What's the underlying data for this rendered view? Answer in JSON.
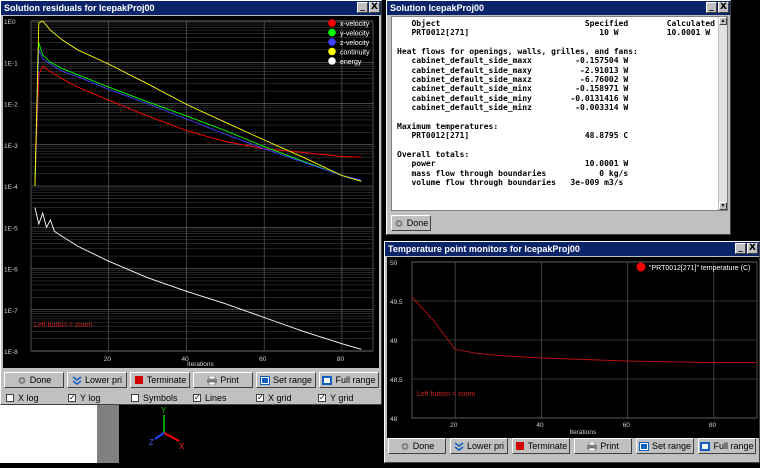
{
  "residuals_window": {
    "title": "Solution residuals for IcepakProj00",
    "title_buttons": [
      "_",
      "X"
    ],
    "legend": [
      {
        "label": "x-velocity",
        "color": "#ff0000"
      },
      {
        "label": "y-velocity",
        "color": "#00ff00"
      },
      {
        "label": "z-velocity",
        "color": "#4040ff"
      },
      {
        "label": "continuity",
        "color": "#ffff00"
      },
      {
        "label": "energy",
        "color": "#ffffff"
      }
    ],
    "y_ticks": [
      "1E0",
      "1E-1",
      "1E-2",
      "1E-3",
      "1E-4",
      "1E-5",
      "1E-6",
      "1E-7",
      "1E-8"
    ],
    "x_ticks": [
      "20",
      "40",
      "60",
      "80"
    ],
    "xlabel": "Iterations",
    "hint": "Left button = zoom",
    "buttons": {
      "done": "Done",
      "lower_pri": "Lower pri",
      "terminate": "Terminate",
      "print": "Print",
      "set_range": "Set range",
      "full_range": "Full range"
    },
    "checks": [
      {
        "label": "X log",
        "checked": false
      },
      {
        "label": "Y log",
        "checked": true
      },
      {
        "label": "Symbols",
        "checked": false
      },
      {
        "label": "Lines",
        "checked": true
      },
      {
        "label": "X grid",
        "checked": true
      },
      {
        "label": "Y grid",
        "checked": true
      }
    ]
  },
  "solution_window": {
    "title": "Solution IcepakProj00",
    "title_buttons": [
      "_",
      "X"
    ],
    "lines": [
      "   Object                              Specified        Calculated",
      "   PRT0012[271]                           10 W          10.0001 W",
      "",
      "Heat flows for openings, walls, grilles, and fans:",
      "   cabinet_default_side_maxx         -0.157504 W",
      "   cabinet_default_side_maxy          -2.91013 W",
      "   cabinet_default_side_maxz          -6.76002 W",
      "   cabinet_default_side_minx         -0.158971 W",
      "   cabinet_default_side_miny        -0.0131416 W",
      "   cabinet_default_side_minz         -0.003314 W",
      "",
      "Maximum temperatures:",
      "   PRT0012[271]                        48.8795 C",
      "",
      "Overall totals:",
      "   power                               10.0001 W",
      "   mass flow through boundaries           0 kg/s",
      "   volume flow through boundaries   3e-009 m3/s"
    ],
    "done": "Done"
  },
  "temp_window": {
    "title": "Temperature point monitors for IcepakProj00",
    "title_buttons": [
      "_",
      "X"
    ],
    "legend": {
      "label": "\"PRT0012[271]\" temperature (C)",
      "color": "#ff0000"
    },
    "y_ticks": [
      "50",
      "49.5",
      "49",
      "48.5",
      "48"
    ],
    "x_ticks": [
      "20",
      "40",
      "60",
      "80"
    ],
    "xlabel": "Iterations",
    "hint": "Left button = zoom",
    "buttons": {
      "done": "Done",
      "lower_pri": "Lower pri",
      "terminate": "Terminate",
      "print": "Print",
      "set_range": "Set range",
      "full_range": "Full range"
    }
  },
  "viewer": {
    "axes": [
      "Y",
      "Z",
      "X"
    ]
  },
  "chart_data": [
    {
      "type": "line",
      "title": "",
      "xlabel": "Iterations",
      "ylabel": "",
      "xlim": [
        0,
        88
      ],
      "ylim": [
        1e-08,
        1
      ],
      "yscale": "log",
      "grid": true,
      "legend_position": "top-right",
      "series": [
        {
          "name": "x-velocity",
          "color": "#ff0000",
          "x": [
            1,
            2,
            3,
            5,
            8,
            12,
            20,
            30,
            40,
            50,
            60,
            70,
            80,
            85
          ],
          "y": [
            0.0001,
            0.05,
            0.08,
            0.06,
            0.04,
            0.025,
            0.012,
            0.005,
            0.0022,
            0.0012,
            0.0008,
            0.00065,
            0.00052,
            0.0005
          ]
        },
        {
          "name": "y-velocity",
          "color": "#00ff00",
          "x": [
            1,
            2,
            3,
            5,
            8,
            12,
            20,
            30,
            40,
            50,
            60,
            70,
            80,
            85
          ],
          "y": [
            0.0001,
            0.3,
            0.15,
            0.1,
            0.07,
            0.05,
            0.025,
            0.011,
            0.005,
            0.0022,
            0.0009,
            0.0004,
            0.00018,
            0.00013
          ]
        },
        {
          "name": "z-velocity",
          "color": "#4040ff",
          "x": [
            1,
            2,
            3,
            5,
            8,
            12,
            20,
            30,
            40,
            50,
            60,
            70,
            80,
            85
          ],
          "y": [
            0.0001,
            0.2,
            0.12,
            0.09,
            0.06,
            0.045,
            0.022,
            0.01,
            0.0042,
            0.0018,
            0.0008,
            0.00038,
            0.00018,
            0.00014
          ]
        },
        {
          "name": "continuity",
          "color": "#ffff00",
          "x": [
            1,
            2,
            3,
            5,
            8,
            12,
            20,
            30,
            40,
            50,
            60,
            70,
            80,
            85
          ],
          "y": [
            0.0001,
            0.9,
            1.0,
            0.6,
            0.35,
            0.2,
            0.09,
            0.03,
            0.0095,
            0.0035,
            0.0013,
            0.0005,
            0.00018,
            0.00013
          ]
        },
        {
          "name": "energy",
          "color": "#ffffff",
          "x": [
            1,
            2,
            3,
            4,
            5,
            6,
            8,
            12,
            20,
            30,
            40,
            50,
            60,
            70,
            80,
            85
          ],
          "y": [
            3e-05,
            1.2e-05,
            2.2e-05,
            1e-05,
            1.5e-05,
            8e-06,
            6e-06,
            3.5e-06,
            1.5e-06,
            6e-07,
            2.8e-07,
            1.4e-07,
            6.5e-08,
            3e-08,
            1.5e-08,
            1.1e-08
          ]
        }
      ]
    },
    {
      "type": "line",
      "title": "",
      "xlabel": "Iterations",
      "ylabel": "",
      "xlim": [
        10,
        90
      ],
      "ylim": [
        48,
        50
      ],
      "grid": true,
      "legend_position": "top-right",
      "series": [
        {
          "name": "\"PRT0012[271]\" temperature (C)",
          "color": "#ff0000",
          "x": [
            10,
            15,
            20,
            25,
            30,
            40,
            50,
            60,
            70,
            80,
            90
          ],
          "y": [
            49.55,
            49.25,
            48.88,
            48.83,
            48.8,
            48.77,
            48.75,
            48.73,
            48.72,
            48.71,
            48.71
          ]
        }
      ]
    }
  ]
}
